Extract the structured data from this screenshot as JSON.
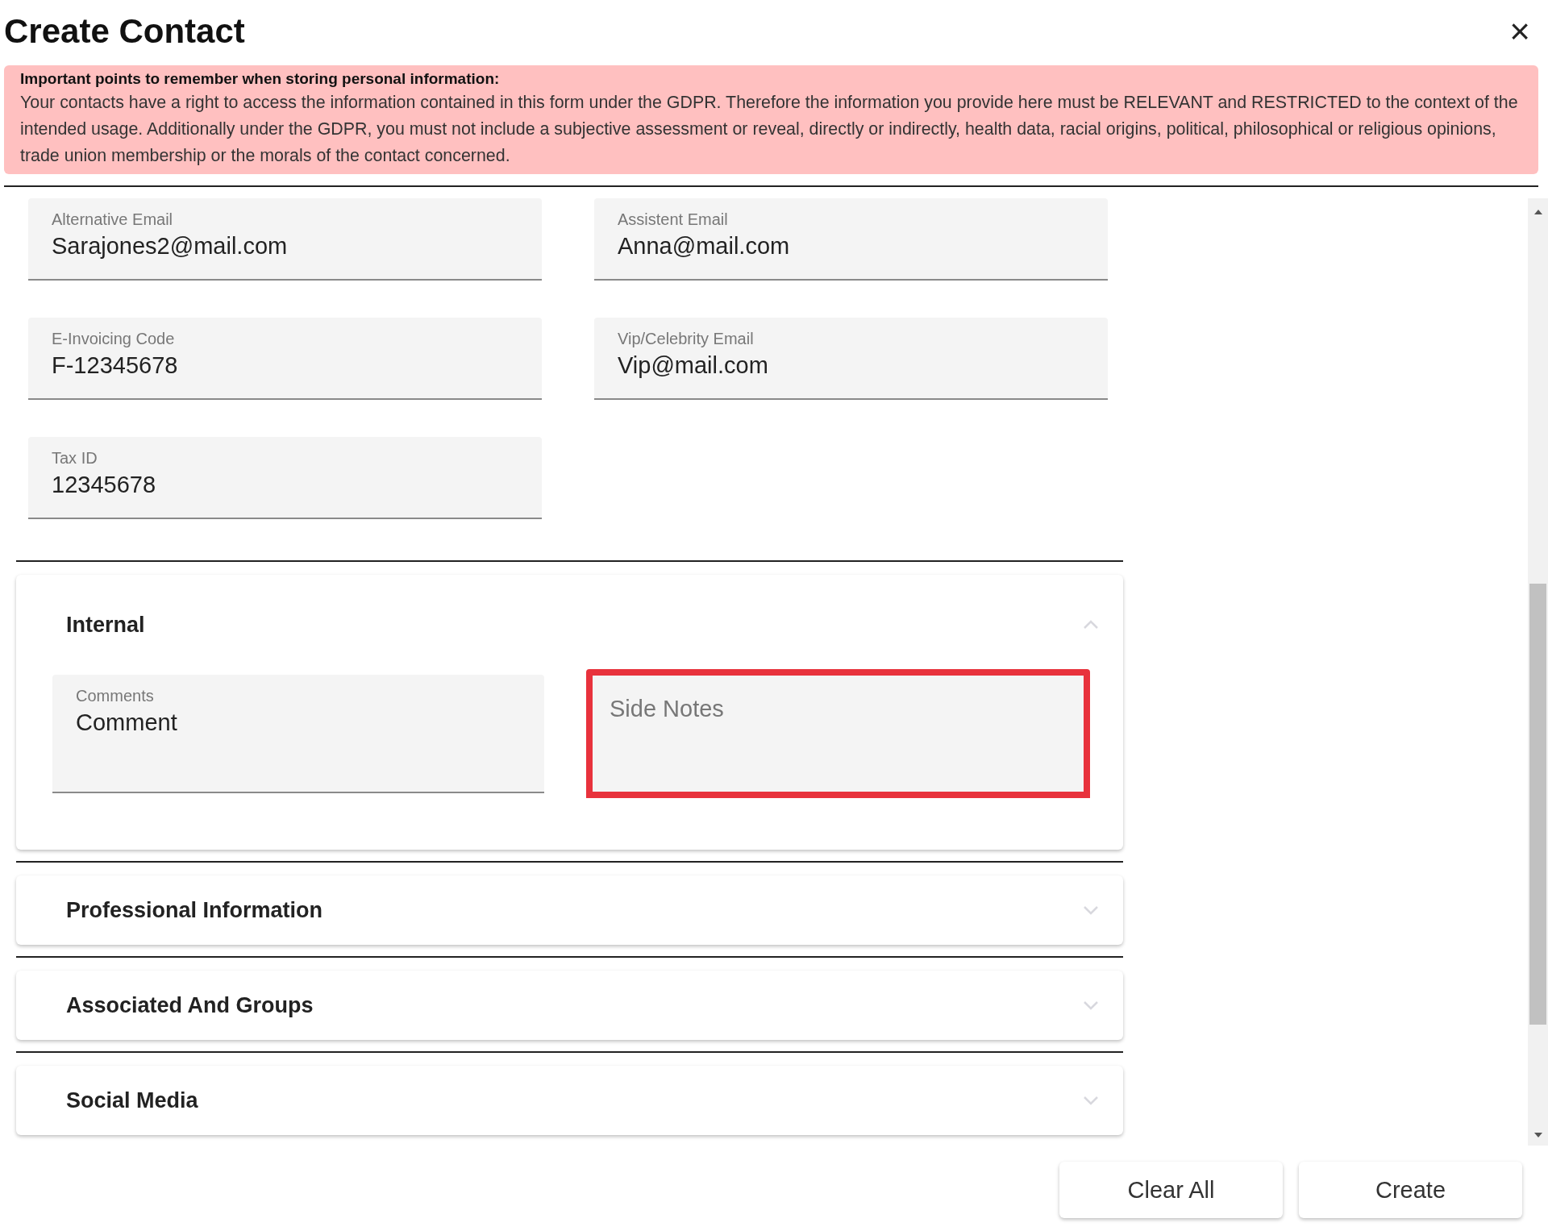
{
  "dialog": {
    "title": "Create Contact",
    "close": "×"
  },
  "notice": {
    "heading": "Important points to remember when storing personal information:",
    "body": "Your contacts have a right to access the information contained in this form under the GDPR. Therefore the information you provide here must be RELEVANT and RESTRICTED to the context of the intended usage. Additionally under the GDPR, you must not include a subjective assessment or reveal, directly or indirectly, health data, racial origins, political, philosophical or religious opinions, trade union membership or the morals of the contact concerned."
  },
  "fields": [
    {
      "label": "Alternative Email",
      "value": "Sarajones2@mail.com"
    },
    {
      "label": "Assistent Email",
      "value": "Anna@mail.com"
    },
    {
      "label": "E-Invoicing Code",
      "value": "F-12345678"
    },
    {
      "label": "Vip/Celebrity Email",
      "value": "Vip@mail.com"
    },
    {
      "label": "Tax ID",
      "value": "12345678"
    }
  ],
  "sections": [
    {
      "title": "Internal",
      "expanded": true,
      "fields": [
        {
          "label": "Comments",
          "value": "Comment",
          "highlighted": false
        },
        {
          "placeholder": "Side Notes",
          "highlighted": true
        }
      ]
    },
    {
      "title": "Professional Information",
      "expanded": false
    },
    {
      "title": "Associated And Groups",
      "expanded": false
    },
    {
      "title": "Social Media",
      "expanded": false
    }
  ],
  "buttons": [
    "Clear All",
    "Create"
  ]
}
